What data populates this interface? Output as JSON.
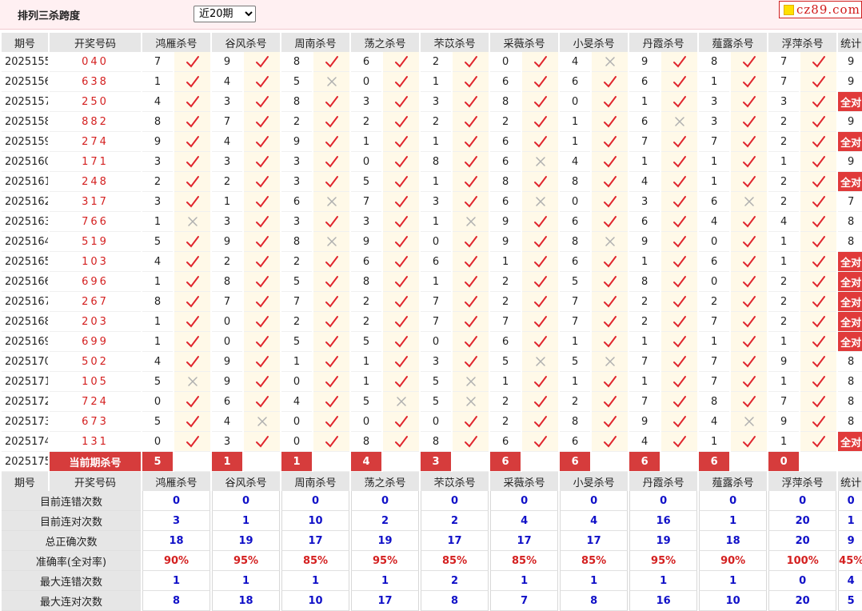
{
  "header": {
    "title": "排列三杀跨度",
    "period_select": "近20期",
    "logo_text": "cz89.com"
  },
  "columns": {
    "issue": "期号",
    "drawn": "开奖号码",
    "experts": [
      "鸿雁杀号",
      "谷风杀号",
      "周南杀号",
      "荡之杀号",
      "芣苡杀号",
      "采薇杀号",
      "小旻杀号",
      "丹霞杀号",
      "薤露杀号",
      "浮萍杀号"
    ],
    "stat": "统计"
  },
  "rows": [
    {
      "issue": "2025155",
      "drawn": "040",
      "kills": [
        7,
        9,
        8,
        6,
        2,
        0,
        4,
        9,
        8,
        7
      ],
      "ok": [
        1,
        1,
        1,
        1,
        1,
        1,
        0,
        1,
        1,
        1
      ],
      "stat": "9"
    },
    {
      "issue": "2025156",
      "drawn": "638",
      "kills": [
        1,
        4,
        5,
        0,
        1,
        6,
        6,
        6,
        1,
        7
      ],
      "ok": [
        1,
        1,
        0,
        1,
        1,
        1,
        1,
        1,
        1,
        1
      ],
      "stat": "9"
    },
    {
      "issue": "2025157",
      "drawn": "250",
      "kills": [
        4,
        3,
        8,
        3,
        3,
        8,
        0,
        1,
        3,
        3
      ],
      "ok": [
        1,
        1,
        1,
        1,
        1,
        1,
        1,
        1,
        1,
        1
      ],
      "stat": "全对"
    },
    {
      "issue": "2025158",
      "drawn": "882",
      "kills": [
        8,
        7,
        2,
        2,
        2,
        2,
        1,
        6,
        3,
        2
      ],
      "ok": [
        1,
        1,
        1,
        1,
        1,
        1,
        1,
        0,
        1,
        1
      ],
      "stat": "9"
    },
    {
      "issue": "2025159",
      "drawn": "274",
      "kills": [
        9,
        4,
        9,
        1,
        1,
        6,
        1,
        7,
        7,
        2
      ],
      "ok": [
        1,
        1,
        1,
        1,
        1,
        1,
        1,
        1,
        1,
        1
      ],
      "stat": "全对"
    },
    {
      "issue": "2025160",
      "drawn": "171",
      "kills": [
        3,
        3,
        3,
        0,
        8,
        6,
        4,
        1,
        1,
        1
      ],
      "ok": [
        1,
        1,
        1,
        1,
        1,
        0,
        1,
        1,
        1,
        1
      ],
      "stat": "9"
    },
    {
      "issue": "2025161",
      "drawn": "248",
      "kills": [
        2,
        2,
        3,
        5,
        1,
        8,
        8,
        4,
        1,
        2
      ],
      "ok": [
        1,
        1,
        1,
        1,
        1,
        1,
        1,
        1,
        1,
        1
      ],
      "stat": "全对"
    },
    {
      "issue": "2025162",
      "drawn": "317",
      "kills": [
        3,
        1,
        6,
        7,
        3,
        6,
        0,
        3,
        6,
        2
      ],
      "ok": [
        1,
        1,
        0,
        1,
        1,
        0,
        1,
        1,
        0,
        1
      ],
      "stat": "7"
    },
    {
      "issue": "2025163",
      "drawn": "766",
      "kills": [
        1,
        3,
        3,
        3,
        1,
        9,
        6,
        6,
        4,
        4
      ],
      "ok": [
        0,
        1,
        1,
        1,
        0,
        1,
        1,
        1,
        1,
        1
      ],
      "stat": "8"
    },
    {
      "issue": "2025164",
      "drawn": "519",
      "kills": [
        5,
        9,
        8,
        9,
        0,
        9,
        8,
        9,
        0,
        1
      ],
      "ok": [
        1,
        1,
        0,
        1,
        1,
        1,
        0,
        1,
        1,
        1
      ],
      "stat": "8"
    },
    {
      "issue": "2025165",
      "drawn": "103",
      "kills": [
        4,
        2,
        2,
        6,
        6,
        1,
        6,
        1,
        6,
        1
      ],
      "ok": [
        1,
        1,
        1,
        1,
        1,
        1,
        1,
        1,
        1,
        1
      ],
      "stat": "全对"
    },
    {
      "issue": "2025166",
      "drawn": "696",
      "kills": [
        1,
        8,
        5,
        8,
        1,
        2,
        5,
        8,
        0,
        2
      ],
      "ok": [
        1,
        1,
        1,
        1,
        1,
        1,
        1,
        1,
        1,
        1
      ],
      "stat": "全对"
    },
    {
      "issue": "2025167",
      "drawn": "267",
      "kills": [
        8,
        7,
        7,
        2,
        7,
        2,
        7,
        2,
        2,
        2
      ],
      "ok": [
        1,
        1,
        1,
        1,
        1,
        1,
        1,
        1,
        1,
        1
      ],
      "stat": "全对"
    },
    {
      "issue": "2025168",
      "drawn": "203",
      "kills": [
        1,
        0,
        2,
        2,
        7,
        7,
        7,
        2,
        7,
        2
      ],
      "ok": [
        1,
        1,
        1,
        1,
        1,
        1,
        1,
        1,
        1,
        1
      ],
      "stat": "全对"
    },
    {
      "issue": "2025169",
      "drawn": "699",
      "kills": [
        1,
        0,
        5,
        5,
        0,
        6,
        1,
        1,
        1,
        1
      ],
      "ok": [
        1,
        1,
        1,
        1,
        1,
        1,
        1,
        1,
        1,
        1
      ],
      "stat": "全对"
    },
    {
      "issue": "2025170",
      "drawn": "502",
      "kills": [
        4,
        9,
        1,
        1,
        3,
        5,
        5,
        7,
        7,
        9
      ],
      "ok": [
        1,
        1,
        1,
        1,
        1,
        0,
        0,
        1,
        1,
        1
      ],
      "stat": "8"
    },
    {
      "issue": "2025171",
      "drawn": "105",
      "kills": [
        5,
        9,
        0,
        1,
        5,
        1,
        1,
        1,
        7,
        1
      ],
      "ok": [
        0,
        1,
        1,
        1,
        0,
        1,
        1,
        1,
        1,
        1
      ],
      "stat": "8"
    },
    {
      "issue": "2025172",
      "drawn": "724",
      "kills": [
        0,
        6,
        4,
        5,
        5,
        2,
        2,
        7,
        8,
        7
      ],
      "ok": [
        1,
        1,
        1,
        0,
        0,
        1,
        1,
        1,
        1,
        1
      ],
      "stat": "8"
    },
    {
      "issue": "2025173",
      "drawn": "673",
      "kills": [
        5,
        4,
        0,
        0,
        0,
        2,
        8,
        9,
        4,
        9
      ],
      "ok": [
        1,
        0,
        1,
        1,
        1,
        1,
        1,
        1,
        0,
        1
      ],
      "stat": "8"
    },
    {
      "issue": "2025174",
      "drawn": "131",
      "kills": [
        0,
        3,
        0,
        8,
        8,
        6,
        6,
        4,
        1,
        1
      ],
      "ok": [
        1,
        1,
        1,
        1,
        1,
        1,
        1,
        1,
        1,
        1
      ],
      "stat": "全对"
    }
  ],
  "current": {
    "issue": "2025175",
    "label": "当前期杀号",
    "kills": [
      "5",
      "1",
      "1",
      "4",
      "3",
      "6",
      "6",
      "6",
      "6",
      "0"
    ]
  },
  "summary": [
    {
      "label": "目前连错次数",
      "values": [
        "0",
        "0",
        "0",
        "0",
        "0",
        "0",
        "0",
        "0",
        "0",
        "0",
        "0"
      ]
    },
    {
      "label": "目前连对次数",
      "values": [
        "3",
        "1",
        "10",
        "2",
        "2",
        "4",
        "4",
        "16",
        "1",
        "20",
        "1"
      ]
    },
    {
      "label": "总正确次数",
      "values": [
        "18",
        "19",
        "17",
        "19",
        "17",
        "17",
        "17",
        "19",
        "18",
        "20",
        "9"
      ]
    },
    {
      "label": "准确率(全对率)",
      "values": [
        "90%",
        "95%",
        "85%",
        "95%",
        "85%",
        "85%",
        "85%",
        "95%",
        "90%",
        "100%",
        "45%"
      ]
    },
    {
      "label": "最大连错次数",
      "values": [
        "1",
        "1",
        "1",
        "1",
        "2",
        "1",
        "1",
        "1",
        "1",
        "0",
        "4"
      ]
    },
    {
      "label": "最大连对次数",
      "values": [
        "8",
        "18",
        "10",
        "17",
        "8",
        "7",
        "8",
        "16",
        "10",
        "20",
        "5"
      ]
    }
  ],
  "icons": {
    "correct": "check-icon",
    "wrong": "cross-icon"
  },
  "colors": {
    "check": "#e0262e",
    "cross": "#b0b0b0",
    "full_bg": "#e03a3a",
    "summary_value": "#1010c8",
    "rate": "#d42020"
  }
}
